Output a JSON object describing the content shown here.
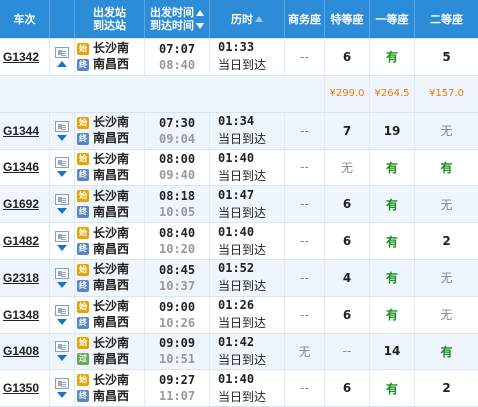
{
  "header": {
    "train_no": "车次",
    "station_top": "出发站",
    "station_bottom": "到达站",
    "time_top": "出发时间",
    "time_bottom": "到达时间",
    "duration": "历时",
    "business": "商务座",
    "premium": "特等座",
    "first": "一等座",
    "second": "二等座"
  },
  "badges": {
    "start": "始",
    "end": "终",
    "pass": "过"
  },
  "trains": [
    {
      "no": "G1342",
      "from": "长沙南",
      "to": "南昌西",
      "dep": "07:07",
      "arr": "08:40",
      "dur": "01:33",
      "arrive_note": "当日到达",
      "business": "--",
      "premium": "6",
      "first": "有",
      "second": "5",
      "expanded": true
    },
    {
      "no": "G1344",
      "from": "长沙南",
      "to": "南昌西",
      "dep": "07:30",
      "arr": "09:04",
      "dur": "01:34",
      "arrive_note": "当日到达",
      "business": "--",
      "premium": "7",
      "first": "19",
      "second": "无"
    },
    {
      "no": "G1346",
      "from": "长沙南",
      "to": "南昌西",
      "dep": "08:00",
      "arr": "09:40",
      "dur": "01:40",
      "arrive_note": "当日到达",
      "business": "--",
      "premium": "无",
      "first": "有",
      "second": "有"
    },
    {
      "no": "G1692",
      "from": "长沙南",
      "to": "南昌西",
      "dep": "08:18",
      "arr": "10:05",
      "dur": "01:47",
      "arrive_note": "当日到达",
      "business": "--",
      "premium": "6",
      "first": "有",
      "second": "无"
    },
    {
      "no": "G1482",
      "from": "长沙南",
      "to": "南昌西",
      "dep": "08:40",
      "arr": "10:20",
      "dur": "01:40",
      "arrive_note": "当日到达",
      "business": "--",
      "premium": "6",
      "first": "有",
      "second": "2"
    },
    {
      "no": "G2318",
      "from": "长沙南",
      "to": "南昌西",
      "dep": "08:45",
      "arr": "10:37",
      "dur": "01:52",
      "arrive_note": "当日到达",
      "business": "--",
      "premium": "4",
      "first": "有",
      "second": "无"
    },
    {
      "no": "G1348",
      "from": "长沙南",
      "to": "南昌西",
      "dep": "09:00",
      "arr": "10:26",
      "dur": "01:26",
      "arrive_note": "当日到达",
      "business": "--",
      "premium": "6",
      "first": "有",
      "second": "无"
    },
    {
      "no": "G1408",
      "from": "长沙南",
      "to": "南昌西",
      "dep": "09:09",
      "arr": "10:51",
      "dur": "01:42",
      "arrive_note": "当日到达",
      "business": "无",
      "premium": "--",
      "first": "14",
      "second": "有",
      "to_badge": "pass"
    },
    {
      "no": "G1350",
      "from": "长沙南",
      "to": "南昌西",
      "dep": "09:27",
      "arr": "11:07",
      "dur": "01:40",
      "arrive_note": "当日到达",
      "business": "--",
      "premium": "6",
      "first": "有",
      "second": "2"
    }
  ],
  "prices": {
    "premium": "¥299.0",
    "first": "¥264.5",
    "second": "¥157.0"
  },
  "colors": {
    "header": "#2d8cd8",
    "have": "#1c8f1c",
    "price": "#f07a00",
    "alt_row": "#eef5fc"
  }
}
